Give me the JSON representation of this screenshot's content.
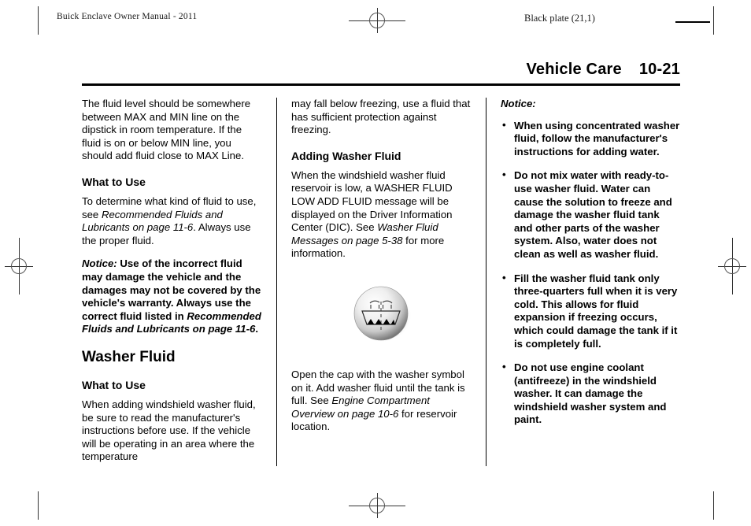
{
  "page": {
    "running_head_left": "Buick Enclave Owner Manual - 2011",
    "running_head_right": "Black plate (21,1)",
    "chapter_title": "Vehicle Care",
    "page_number": "10-21"
  },
  "column1": {
    "intro_paragraph": "The fluid level should be somewhere between MAX and MIN line on the dipstick in room temperature. If the fluid is on or below MIN line, you should add fluid close to MAX Line.",
    "what_to_use_heading": "What to Use",
    "what_to_use_text_before": "To determine what kind of fluid to use, see ",
    "what_to_use_xref": "Recommended Fluids and Lubricants on page 11-6",
    "what_to_use_text_after": ". Always use the proper fluid.",
    "notice_label": "Notice:",
    "notice_text_before": " Use of the incorrect fluid may damage the vehicle and the damages may not be covered by the vehicle's warranty. Always use the correct fluid listed in ",
    "notice_xref": "Recommended Fluids and Lubricants on page 11-6",
    "notice_text_after": ".",
    "washer_fluid_heading": "Washer Fluid",
    "washer_what_to_use_heading": "What to Use",
    "washer_paragraph": "When adding windshield washer fluid, be sure to read the manufacturer's instructions before use. If the vehicle will be operating in an area where the temperature"
  },
  "column2": {
    "continued_paragraph": "may fall below freezing, use a fluid that has sufficient protection against freezing.",
    "adding_heading": "Adding Washer Fluid",
    "dic_text_before": "When the windshield washer fluid reservoir is low, a WASHER FLUID LOW ADD FLUID message will be displayed on the Driver Information Center (DIC). See ",
    "dic_xref": "Washer Fluid Messages on page 5-38",
    "dic_text_after": " for more information.",
    "figure_caption_before": "Open the cap with the washer symbol on it. Add washer fluid until the tank is full. See ",
    "figure_caption_xref": "Engine Compartment Overview on page 10-6",
    "figure_caption_after": " for reservoir location."
  },
  "column3": {
    "notice_label": "Notice:",
    "bullet_marker": "•",
    "bullets": [
      "When using concentrated washer fluid, follow the manufacturer's instructions for adding water.",
      "Do not mix water with ready-to-use washer fluid. Water can cause the solution to freeze and damage the washer fluid tank and other parts of the washer system. Also, water does not clean as well as washer fluid.",
      "Fill the washer fluid tank only three-quarters full when it is very cold. This allows for fluid expansion if freezing occurs, which could damage the tank if it is completely full.",
      "Do not use engine coolant (antifreeze) in the windshield washer. It can damage the windshield washer system and paint."
    ]
  },
  "figure": {
    "name": "washer-fluid-cap-symbol",
    "description": "Circular washer fluid reservoir cap showing windshield washer spray symbol"
  }
}
